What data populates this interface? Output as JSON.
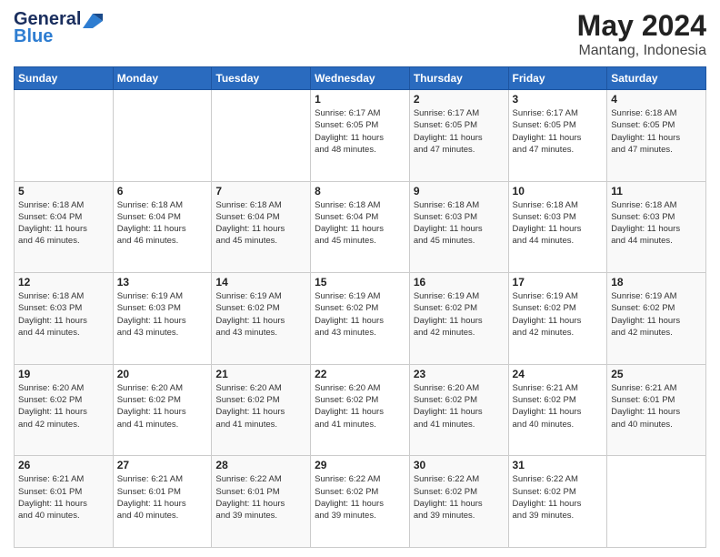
{
  "logo": {
    "text1": "General",
    "text2": "Blue"
  },
  "header": {
    "month": "May 2024",
    "location": "Mantang, Indonesia"
  },
  "weekdays": [
    "Sunday",
    "Monday",
    "Tuesday",
    "Wednesday",
    "Thursday",
    "Friday",
    "Saturday"
  ],
  "weeks": [
    [
      {
        "day": "",
        "info": ""
      },
      {
        "day": "",
        "info": ""
      },
      {
        "day": "",
        "info": ""
      },
      {
        "day": "1",
        "info": "Sunrise: 6:17 AM\nSunset: 6:05 PM\nDaylight: 11 hours\nand 48 minutes."
      },
      {
        "day": "2",
        "info": "Sunrise: 6:17 AM\nSunset: 6:05 PM\nDaylight: 11 hours\nand 47 minutes."
      },
      {
        "day": "3",
        "info": "Sunrise: 6:17 AM\nSunset: 6:05 PM\nDaylight: 11 hours\nand 47 minutes."
      },
      {
        "day": "4",
        "info": "Sunrise: 6:18 AM\nSunset: 6:05 PM\nDaylight: 11 hours\nand 47 minutes."
      }
    ],
    [
      {
        "day": "5",
        "info": "Sunrise: 6:18 AM\nSunset: 6:04 PM\nDaylight: 11 hours\nand 46 minutes."
      },
      {
        "day": "6",
        "info": "Sunrise: 6:18 AM\nSunset: 6:04 PM\nDaylight: 11 hours\nand 46 minutes."
      },
      {
        "day": "7",
        "info": "Sunrise: 6:18 AM\nSunset: 6:04 PM\nDaylight: 11 hours\nand 45 minutes."
      },
      {
        "day": "8",
        "info": "Sunrise: 6:18 AM\nSunset: 6:04 PM\nDaylight: 11 hours\nand 45 minutes."
      },
      {
        "day": "9",
        "info": "Sunrise: 6:18 AM\nSunset: 6:03 PM\nDaylight: 11 hours\nand 45 minutes."
      },
      {
        "day": "10",
        "info": "Sunrise: 6:18 AM\nSunset: 6:03 PM\nDaylight: 11 hours\nand 44 minutes."
      },
      {
        "day": "11",
        "info": "Sunrise: 6:18 AM\nSunset: 6:03 PM\nDaylight: 11 hours\nand 44 minutes."
      }
    ],
    [
      {
        "day": "12",
        "info": "Sunrise: 6:18 AM\nSunset: 6:03 PM\nDaylight: 11 hours\nand 44 minutes."
      },
      {
        "day": "13",
        "info": "Sunrise: 6:19 AM\nSunset: 6:03 PM\nDaylight: 11 hours\nand 43 minutes."
      },
      {
        "day": "14",
        "info": "Sunrise: 6:19 AM\nSunset: 6:02 PM\nDaylight: 11 hours\nand 43 minutes."
      },
      {
        "day": "15",
        "info": "Sunrise: 6:19 AM\nSunset: 6:02 PM\nDaylight: 11 hours\nand 43 minutes."
      },
      {
        "day": "16",
        "info": "Sunrise: 6:19 AM\nSunset: 6:02 PM\nDaylight: 11 hours\nand 42 minutes."
      },
      {
        "day": "17",
        "info": "Sunrise: 6:19 AM\nSunset: 6:02 PM\nDaylight: 11 hours\nand 42 minutes."
      },
      {
        "day": "18",
        "info": "Sunrise: 6:19 AM\nSunset: 6:02 PM\nDaylight: 11 hours\nand 42 minutes."
      }
    ],
    [
      {
        "day": "19",
        "info": "Sunrise: 6:20 AM\nSunset: 6:02 PM\nDaylight: 11 hours\nand 42 minutes."
      },
      {
        "day": "20",
        "info": "Sunrise: 6:20 AM\nSunset: 6:02 PM\nDaylight: 11 hours\nand 41 minutes."
      },
      {
        "day": "21",
        "info": "Sunrise: 6:20 AM\nSunset: 6:02 PM\nDaylight: 11 hours\nand 41 minutes."
      },
      {
        "day": "22",
        "info": "Sunrise: 6:20 AM\nSunset: 6:02 PM\nDaylight: 11 hours\nand 41 minutes."
      },
      {
        "day": "23",
        "info": "Sunrise: 6:20 AM\nSunset: 6:02 PM\nDaylight: 11 hours\nand 41 minutes."
      },
      {
        "day": "24",
        "info": "Sunrise: 6:21 AM\nSunset: 6:02 PM\nDaylight: 11 hours\nand 40 minutes."
      },
      {
        "day": "25",
        "info": "Sunrise: 6:21 AM\nSunset: 6:01 PM\nDaylight: 11 hours\nand 40 minutes."
      }
    ],
    [
      {
        "day": "26",
        "info": "Sunrise: 6:21 AM\nSunset: 6:01 PM\nDaylight: 11 hours\nand 40 minutes."
      },
      {
        "day": "27",
        "info": "Sunrise: 6:21 AM\nSunset: 6:01 PM\nDaylight: 11 hours\nand 40 minutes."
      },
      {
        "day": "28",
        "info": "Sunrise: 6:22 AM\nSunset: 6:01 PM\nDaylight: 11 hours\nand 39 minutes."
      },
      {
        "day": "29",
        "info": "Sunrise: 6:22 AM\nSunset: 6:02 PM\nDaylight: 11 hours\nand 39 minutes."
      },
      {
        "day": "30",
        "info": "Sunrise: 6:22 AM\nSunset: 6:02 PM\nDaylight: 11 hours\nand 39 minutes."
      },
      {
        "day": "31",
        "info": "Sunrise: 6:22 AM\nSunset: 6:02 PM\nDaylight: 11 hours\nand 39 minutes."
      },
      {
        "day": "",
        "info": ""
      }
    ]
  ]
}
